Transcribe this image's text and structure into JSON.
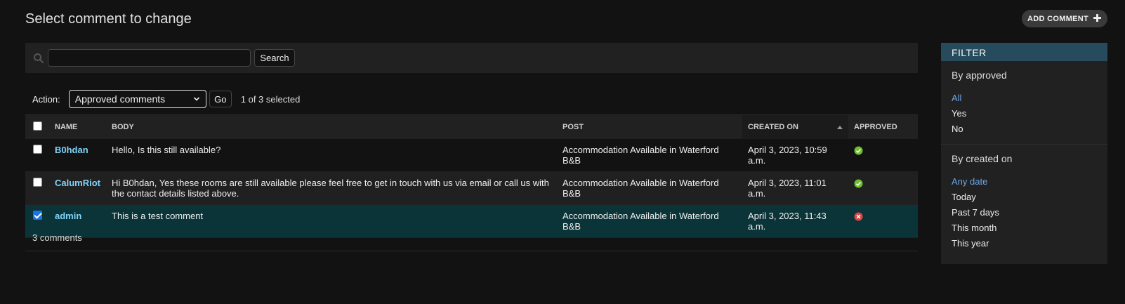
{
  "page": {
    "title": "Select comment to change",
    "add_label": "ADD COMMENT"
  },
  "search": {
    "value": "",
    "placeholder": "",
    "button": "Search"
  },
  "actions": {
    "label": "Action:",
    "selected_option": "Approved comments",
    "go": "Go",
    "selection": "1 of 3 selected"
  },
  "table": {
    "columns": [
      "Name",
      "Body",
      "Post",
      "Created on",
      "Approved"
    ],
    "rows": [
      {
        "name": "B0hdan",
        "body": "Hello, Is this still available?",
        "post": "Accommodation Available in Waterford B&B",
        "created": "April 3, 2023, 10:59 a.m.",
        "approved": "yes",
        "checked": false
      },
      {
        "name": "CalumRiot",
        "body": "Hi B0hdan, Yes these rooms are still available please feel free to get in touch with us via email or call us with the contact details listed above.",
        "post": "Accommodation Available in Waterford B&B",
        "created": "April 3, 2023, 11:01 a.m.",
        "approved": "yes",
        "checked": false
      },
      {
        "name": "admin",
        "body": "This is a test comment",
        "post": "Accommodation Available in Waterford B&B",
        "created": "April 3, 2023, 11:43 a.m.",
        "approved": "no",
        "checked": true
      }
    ],
    "count": "3 comments"
  },
  "filter": {
    "header": "FILTER",
    "groups": [
      {
        "title": "By approved",
        "options": [
          "All",
          "Yes",
          "No"
        ],
        "active": "All"
      },
      {
        "title": "By created on",
        "options": [
          "Any date",
          "Today",
          "Past 7 days",
          "This month",
          "This year"
        ],
        "active": "Any date"
      }
    ]
  },
  "colors": {
    "accent_link": "#81d4fa",
    "filter_header": "#264b5d",
    "approved_yes": "#70bf2b",
    "approved_no": "#dd4646",
    "selected_row": "#0a3438"
  }
}
